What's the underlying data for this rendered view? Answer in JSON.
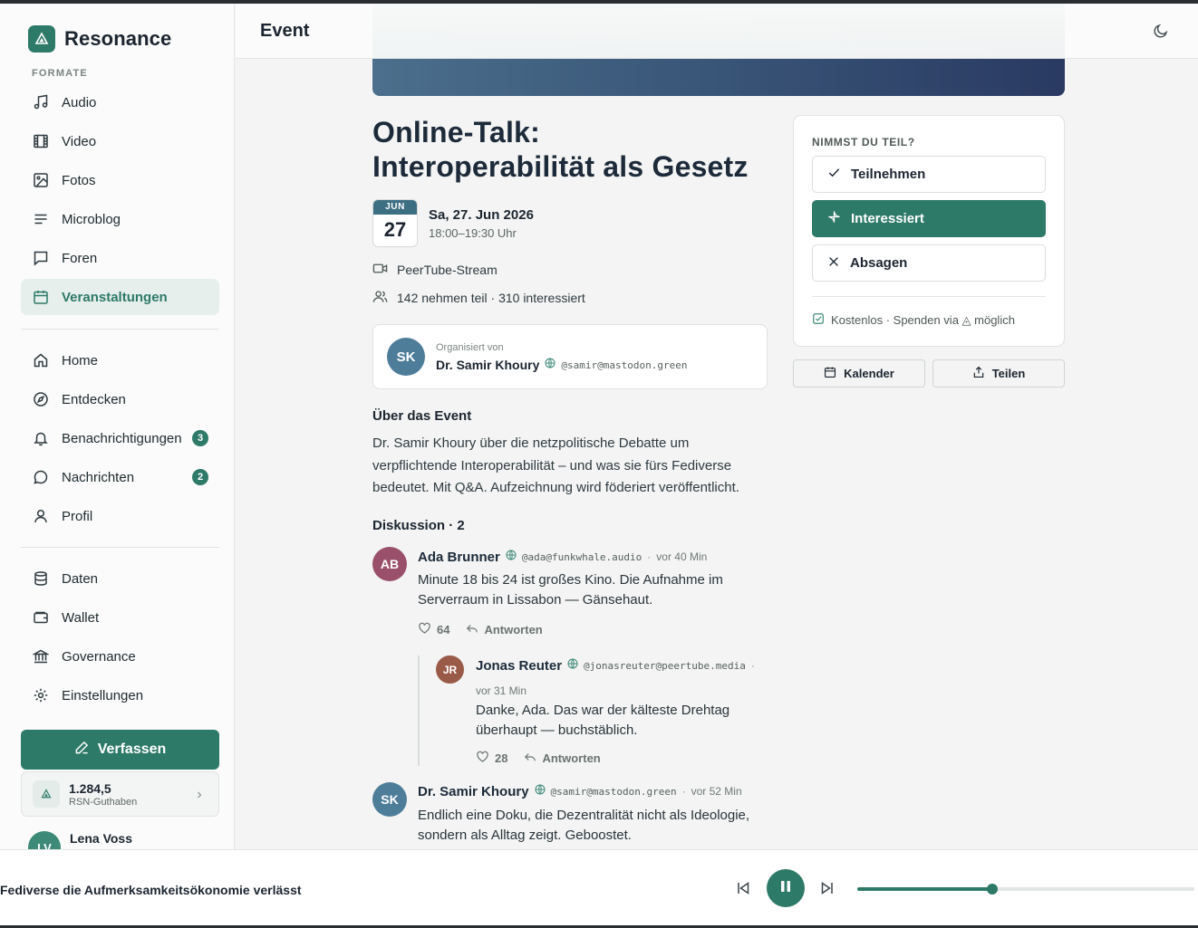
{
  "app": {
    "name": "Resonance",
    "brand_color": "#2e7a68"
  },
  "sidebar": {
    "section_label": "FORMATE",
    "formats": [
      {
        "label": "Audio",
        "icon": "music-note-icon"
      },
      {
        "label": "Video",
        "icon": "film-icon"
      },
      {
        "label": "Fotos",
        "icon": "image-icon"
      },
      {
        "label": "Microblog",
        "icon": "text-lines-icon"
      },
      {
        "label": "Foren",
        "icon": "speech-bubble-icon"
      },
      {
        "label": "Veranstaltungen",
        "icon": "calendar-icon",
        "active": true
      }
    ],
    "main_nav": [
      {
        "label": "Home",
        "icon": "home-icon"
      },
      {
        "label": "Entdecken",
        "icon": "compass-icon"
      },
      {
        "label": "Benachrichtigungen",
        "icon": "bell-icon",
        "badge": "3"
      },
      {
        "label": "Nachrichten",
        "icon": "chat-icon",
        "badge": "2"
      },
      {
        "label": "Profil",
        "icon": "user-icon"
      }
    ],
    "extra_nav": [
      {
        "label": "Daten",
        "icon": "database-icon"
      },
      {
        "label": "Wallet",
        "icon": "wallet-icon"
      },
      {
        "label": "Governance",
        "icon": "bank-icon"
      },
      {
        "label": "Einstellungen",
        "icon": "gear-icon"
      }
    ],
    "compose_label": "Verfassen",
    "wallet": {
      "amount": "1.284,5",
      "label": "RSN-Guthaben"
    },
    "user": {
      "name": "Lena Voss",
      "initials": "LV"
    }
  },
  "header": {
    "title": "Event"
  },
  "event": {
    "title_line1": "Online-Talk:",
    "title_line2": "Interoperabilität als Gesetz",
    "date_month": "JUN",
    "date_day": "27",
    "date_full": "Sa, 27. Jun 2026",
    "time": "18:00–19:30 Uhr",
    "location": "PeerTube-Stream",
    "attendance": "142 nehmen teil · 310 interessiert",
    "organizer": {
      "label": "Organisiert von",
      "name": "Dr. Samir Khoury",
      "handle": "@samir@mastodon.green",
      "initials": "SK"
    },
    "about_heading": "Über das Event",
    "about_text": "Dr. Samir Khoury über die netzpolitische Debatte um verpflichtende Interoperabilität – und was sie fürs Fediverse bedeutet. Mit Q&A. Aufzeichnung wird föderiert veröffentlicht.",
    "discussion_heading": "Diskussion · 2"
  },
  "comments": [
    {
      "initials": "AB",
      "color": "#9a4f6a",
      "author": "Ada Brunner",
      "handle": "@ada@funkwhale.audio",
      "time": "vor 40 Min",
      "text": "Minute 18 bis 24 ist großes Kino. Die Aufnahme im Serverraum in Lissabon — Gänsehaut.",
      "likes": "64",
      "reply_label": "Antworten"
    },
    {
      "initials": "JR",
      "color": "#9a5a48",
      "author": "Jonas Reuter",
      "handle": "@jonasreuter@peertube.media",
      "time": "vor 31 Min",
      "text": "Danke, Ada. Das war der kälteste Drehtag überhaupt — buchstäblich.",
      "likes": "28",
      "reply_label": "Antworten"
    },
    {
      "initials": "SK",
      "color": "#4e7d9a",
      "author": "Dr. Samir Khoury",
      "handle": "@samir@mastodon.green",
      "time": "vor 52 Min",
      "text": "Endlich eine Doku, die Dezentralität nicht als Ideologie, sondern als Alltag zeigt. Geboostet."
    }
  ],
  "rsvp": {
    "label": "NIMMST DU TEIL?",
    "options": [
      {
        "label": "Teilnehmen",
        "icon": "check-icon"
      },
      {
        "label": "Interessiert",
        "icon": "sparkle-icon",
        "selected": true
      },
      {
        "label": "Absagen",
        "icon": "x-icon"
      }
    ],
    "note": "Kostenlos · Spenden via ◬ möglich",
    "calendar_label": "Kalender",
    "share_label": "Teilen"
  },
  "player": {
    "title": "Fediverse die Aufmerksamkeitsökonomie verlässt",
    "progress": 0.4
  }
}
